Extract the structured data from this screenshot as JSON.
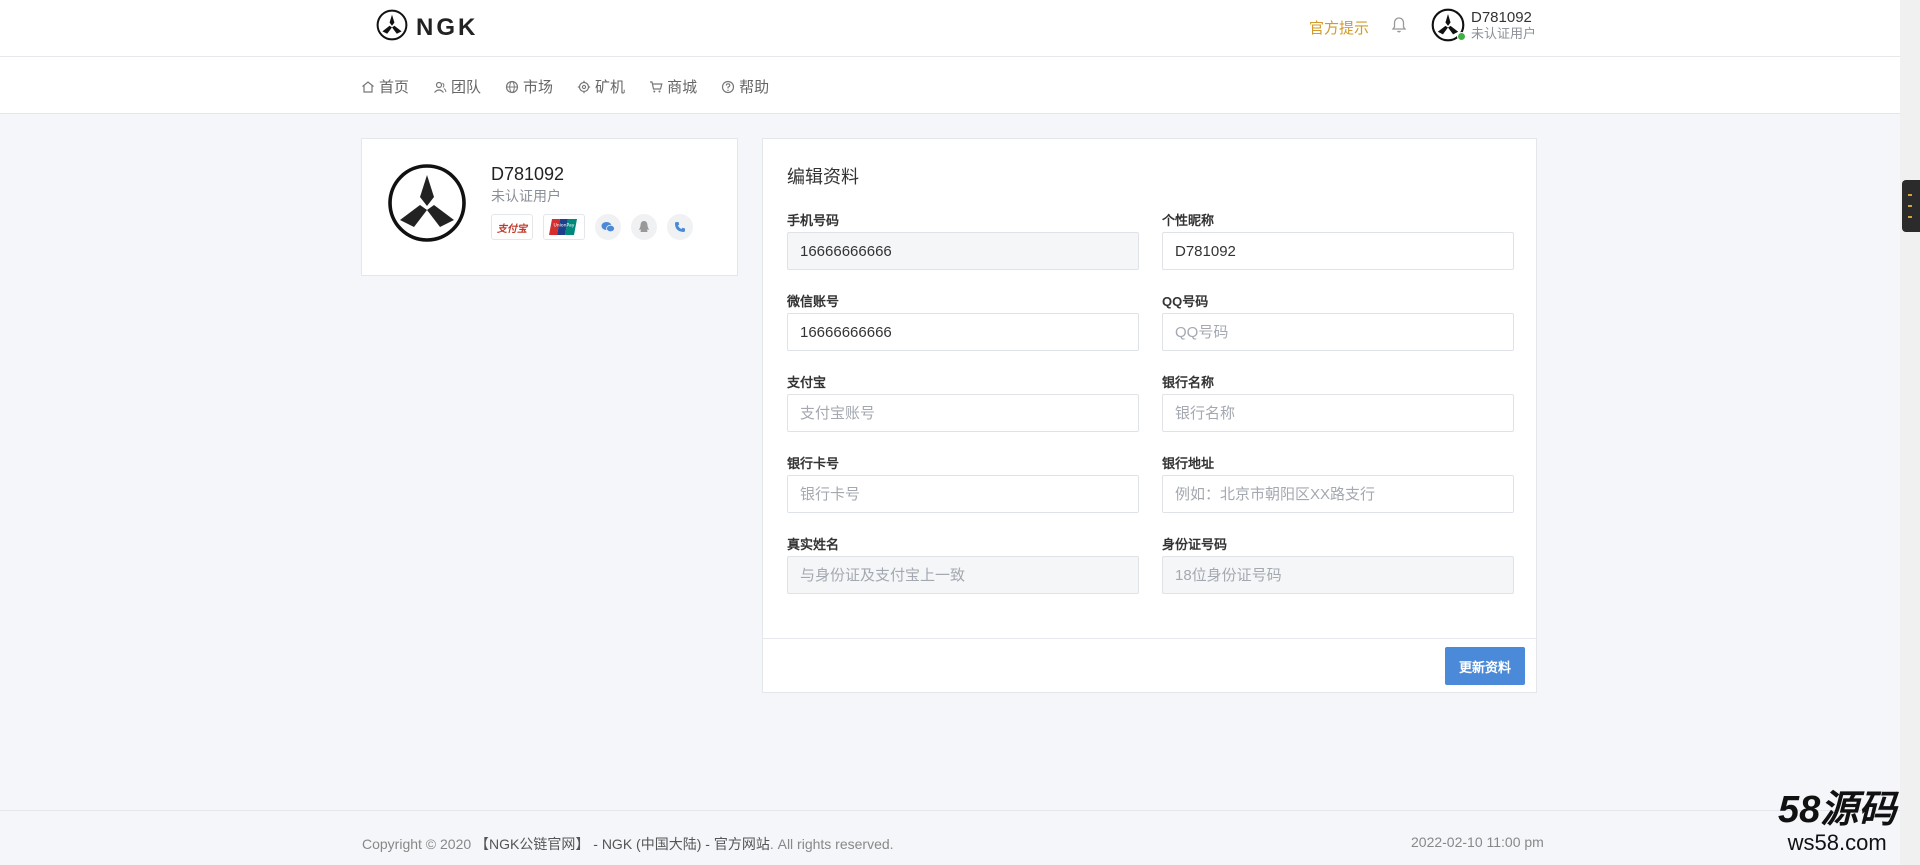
{
  "header": {
    "logo_text": "NGK",
    "notice_label": "官方提示",
    "user": {
      "name": "D781092",
      "status": "未认证用户"
    }
  },
  "nav": {
    "items": [
      {
        "label": "首页",
        "icon": "home-icon"
      },
      {
        "label": "团队",
        "icon": "team-icon"
      },
      {
        "label": "市场",
        "icon": "globe-icon"
      },
      {
        "label": "矿机",
        "icon": "gear-icon"
      },
      {
        "label": "商城",
        "icon": "cart-icon"
      },
      {
        "label": "帮助",
        "icon": "help-icon"
      }
    ]
  },
  "profile": {
    "name": "D781092",
    "status": "未认证用户",
    "bindings": [
      {
        "label": "支付宝",
        "icon": "alipay-icon"
      },
      {
        "label": "UnionPay",
        "icon": "unionpay-icon"
      },
      {
        "icon": "wechat-icon"
      },
      {
        "icon": "qq-icon"
      },
      {
        "icon": "phone-icon"
      }
    ]
  },
  "form": {
    "title": "编辑资料",
    "phone": {
      "label": "手机号码",
      "value": "16666666666"
    },
    "nickname": {
      "label": "个性昵称",
      "value": "D781092"
    },
    "wechat": {
      "label": "微信账号",
      "value": "16666666666"
    },
    "qq": {
      "label": "QQ号码",
      "placeholder": "QQ号码"
    },
    "alipay": {
      "label": "支付宝",
      "placeholder": "支付宝账号"
    },
    "bank_name": {
      "label": "银行名称",
      "placeholder": "银行名称"
    },
    "bank_card": {
      "label": "银行卡号",
      "placeholder": "银行卡号"
    },
    "bank_address": {
      "label": "银行地址",
      "placeholder": "例如：北京市朝阳区XX路支行"
    },
    "real_name": {
      "label": "真实姓名",
      "placeholder": "与身份证及支付宝上一致"
    },
    "id_number": {
      "label": "身份证号码",
      "placeholder": "18位身份证号码"
    },
    "submit_label": "更新资料"
  },
  "footer": {
    "copyright_prefix": "Copyright © 2020 ",
    "site_name": "【NGK公链官网】 - NGK (中国大陆) - 官方网站",
    "rights": ". All rights reserved.",
    "datetime": "2022-02-10 11:00 pm"
  },
  "watermark": {
    "big": "58源码",
    "small": "ws58.com"
  },
  "colors": {
    "accent": "#4a8ad8",
    "notice": "#d09a2c",
    "online": "#43b047"
  }
}
